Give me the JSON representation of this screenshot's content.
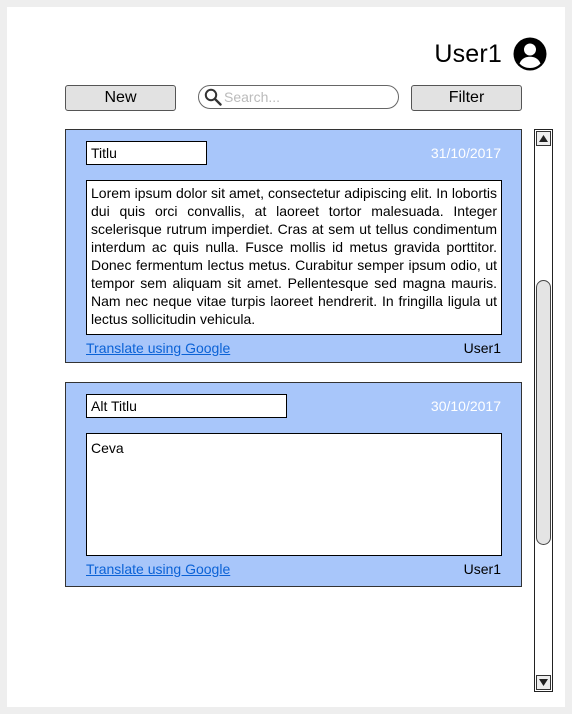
{
  "header": {
    "user_name": "User1",
    "user_icon": "account-circle-icon"
  },
  "toolbar": {
    "new_label": "New",
    "search_placeholder": "Search...",
    "search_value": "",
    "filter_label": "Filter"
  },
  "posts": [
    {
      "title": "Titlu",
      "date": "31/10/2017",
      "body": "Lorem ipsum dolor sit amet, consectetur adipiscing elit. In lobortis dui quis orci convallis, at laoreet tortor malesuada. Integer scelerisque rutrum imperdiet. Cras at sem ut tellus condimentum interdum ac quis nulla. Fusce mollis id metus gravida porttitor. Donec fermentum lectus metus. Curabitur semper ipsum odio, ut tempor sem aliquam sit amet. Pellentesque sed magna mauris. Nam nec neque vitae turpis laoreet hendrerit. In fringilla ligula ut lectus sollicitudin vehicula.",
      "translate_label": "Translate using Google",
      "author": "User1"
    },
    {
      "title": "Alt Titlu",
      "date": "30/10/2017",
      "body": "Ceva",
      "translate_label": "Translate using Google",
      "author": "User1"
    }
  ],
  "colors": {
    "post_background": "#a8c6fa",
    "link": "#0b62d6",
    "date_text": "#ffffff"
  }
}
